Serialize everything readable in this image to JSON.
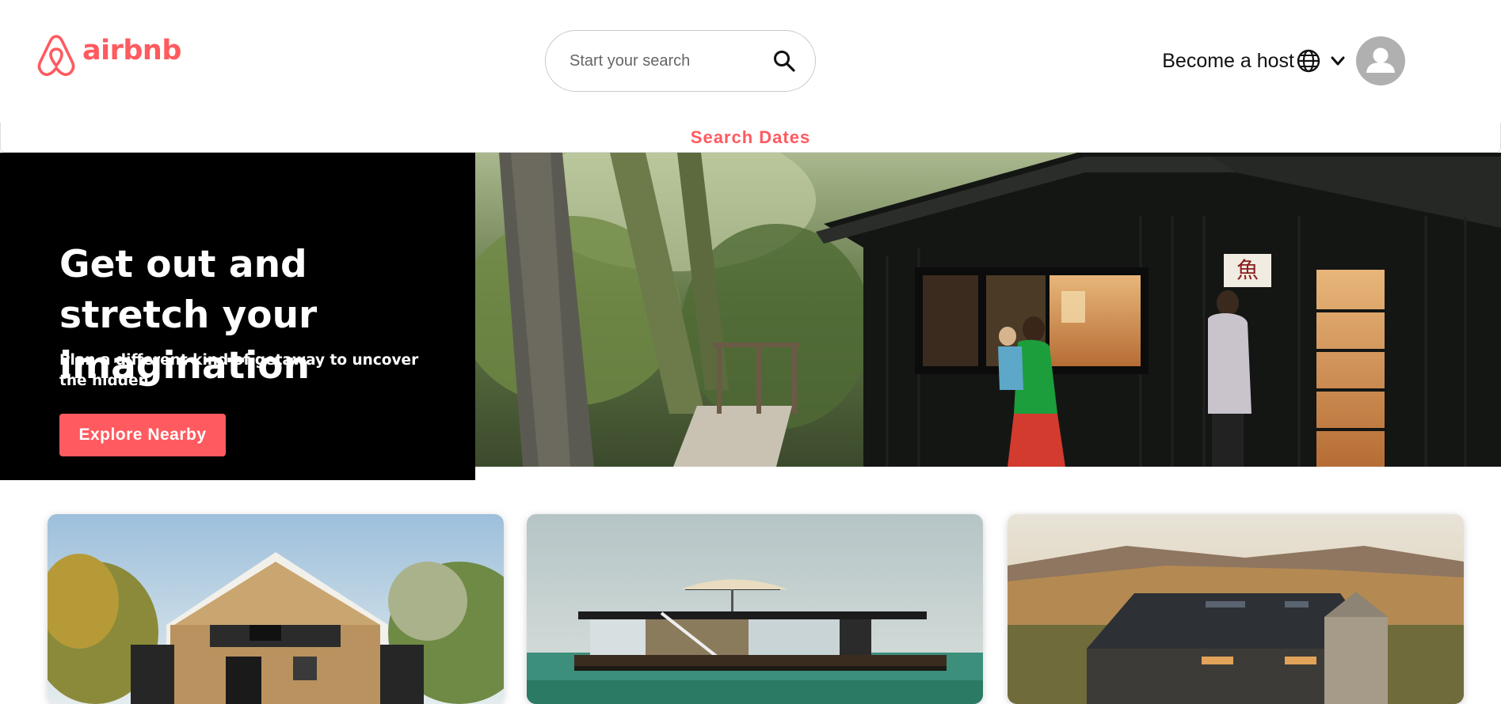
{
  "header": {
    "logo_text": "airbnb",
    "search": {
      "placeholder": "Start your search"
    },
    "become_host_label": "Become a host",
    "icons": {
      "search": "search-icon",
      "globe": "globe-icon",
      "chevron": "chevron-down-icon",
      "avatar": "user-avatar-icon"
    }
  },
  "search_dates": {
    "label": "Search Dates"
  },
  "hero": {
    "title": "Get out and stretch your imagination",
    "subtitle": "Plan a different kind of getaway to uncover the hidden",
    "cta_label": "Explore Nearby"
  },
  "colors": {
    "brand": "#ff5a5f",
    "hero_bg": "#000000"
  }
}
